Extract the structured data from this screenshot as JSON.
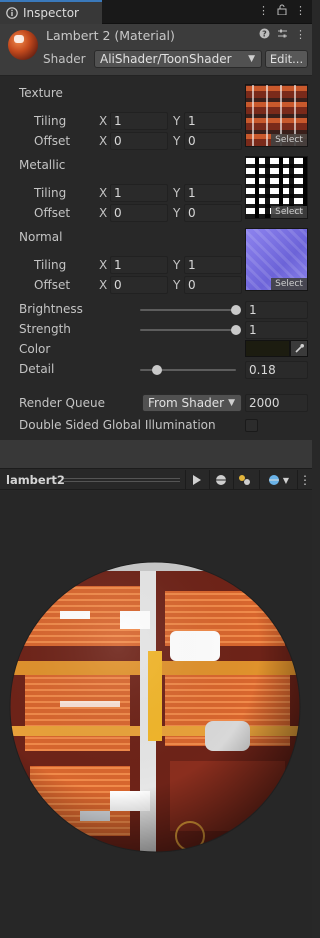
{
  "tab": {
    "label": "Inspector"
  },
  "material": {
    "title": "Lambert 2 (Material)",
    "shader_label": "Shader",
    "shader_value": "AliShader/ToonShader",
    "edit_label": "Edit..."
  },
  "labels": {
    "tiling": "Tiling",
    "offset": "Offset",
    "x": "X",
    "y": "Y",
    "select": "Select"
  },
  "textures": [
    {
      "name": "Texture",
      "tiling_x": "1",
      "tiling_y": "1",
      "offset_x": "0",
      "offset_y": "0"
    },
    {
      "name": "Metallic",
      "tiling_x": "1",
      "tiling_y": "1",
      "offset_x": "0",
      "offset_y": "0"
    },
    {
      "name": "Normal",
      "tiling_x": "1",
      "tiling_y": "1",
      "offset_x": "0",
      "offset_y": "0"
    }
  ],
  "brightness": {
    "label": "Brightness",
    "value": "1",
    "fraction": 1.0
  },
  "strength": {
    "label": "Strength",
    "value": "1",
    "fraction": 1.0
  },
  "color": {
    "label": "Color",
    "value": "#1c1c10"
  },
  "detail": {
    "label": "Detail",
    "value": "0.18",
    "fraction": 0.18
  },
  "render_queue": {
    "label": "Render Queue",
    "dropdown": "From Shader",
    "value": "2000"
  },
  "dsgi": {
    "label": "Double Sided Global Illumination",
    "checked": false
  },
  "preview": {
    "title": "lambert2"
  },
  "colors": {
    "accent": "#3a79bb",
    "panel": "#383838",
    "field": "#2a2a2a"
  }
}
